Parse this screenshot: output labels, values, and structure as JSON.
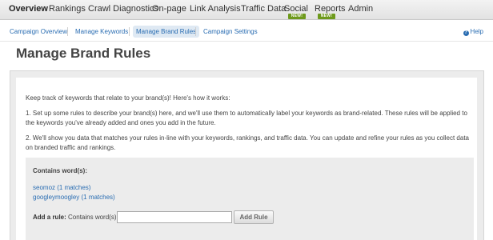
{
  "top_nav": {
    "items": [
      {
        "label": "Overview"
      },
      {
        "label": "Rankings"
      },
      {
        "label": "Crawl Diagnostics"
      },
      {
        "label": "On-page"
      },
      {
        "label": "Link Analysis"
      },
      {
        "label": "Traffic Data"
      },
      {
        "label": "Social",
        "badge": "NEW!"
      },
      {
        "label": "Reports",
        "badge": "NEW!"
      },
      {
        "label": "Admin"
      }
    ],
    "active": "Overview",
    "badge_color": "#6e9a1c"
  },
  "sub_nav": {
    "items": [
      {
        "label": "Campaign Overview"
      },
      {
        "label": "Manage Keywords"
      },
      {
        "label": "Manage Brand Rules"
      },
      {
        "label": "Campaign Settings"
      }
    ],
    "active": "Manage Brand Rules",
    "help_label": "Help",
    "help_icon": "question-circle-icon"
  },
  "page_title": "Manage Brand Rules",
  "intro": {
    "line": "Keep track of keywords that relate to your brand(s)! Here's how it works:",
    "step1": "1. Set up some rules to describe your brand(s) here, and we'll use them to automatically label your keywords as brand-related. These rules will be applied to the keywords you've already added and ones you add in the future.",
    "step2": "2. We'll show you data that matches your rules in-line with your keywords, rankings, and traffic data. You can update and refine your rules as you collect data on branded traffic and rankings."
  },
  "rules": {
    "heading": "Contains word(s):",
    "items": [
      {
        "label": "seomoz (1 matches)"
      },
      {
        "label": "googleymoogley (1 matches)"
      }
    ],
    "add_rule_label": "Add a rule:",
    "add_rule_type": "Contains word(s)",
    "input_value": "",
    "input_placeholder": "",
    "button_label": "Add Rule"
  },
  "colors": {
    "link": "#2a6db2",
    "panel_bg": "#ececec",
    "active_tab_bg": "#dfe9f3"
  }
}
